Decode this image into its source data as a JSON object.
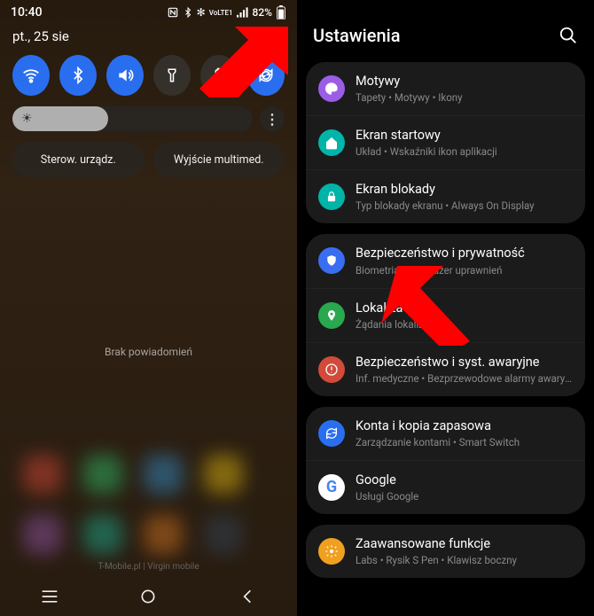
{
  "status": {
    "time": "10:40",
    "battery": "82%",
    "lte_label": "VoLTE1"
  },
  "date": "pt., 25 sie",
  "toggles": [
    {
      "name": "wifi",
      "on": true
    },
    {
      "name": "bluetooth",
      "on": true
    },
    {
      "name": "sound",
      "on": true
    },
    {
      "name": "flashlight",
      "on": false
    },
    {
      "name": "power-saving",
      "on": false
    },
    {
      "name": "rotate",
      "on": true
    }
  ],
  "brightness_percent": 40,
  "shortcuts": {
    "devices": "Sterow. urządz.",
    "media": "Wyjście multimed."
  },
  "no_notifications": "Brak powiadomień",
  "carrier": "T-Mobile.pl | Virgin mobile",
  "settings_title": "Ustawienia",
  "groups": [
    [
      {
        "icon": "themes",
        "color": "#9b5de5",
        "title": "Motywy",
        "sub": "Tapety  •  Motywy  •  Ikony"
      },
      {
        "icon": "home",
        "color": "#00b4a8",
        "title": "Ekran startowy",
        "sub": "Układ  •  Wskaźniki ikon aplikacji"
      },
      {
        "icon": "lock",
        "color": "#00b4a8",
        "title": "Ekran blokady",
        "sub": "Typ blokady ekranu  •  Always On Display"
      }
    ],
    [
      {
        "icon": "shield",
        "color": "#3a6ef0",
        "title": "Bezpieczeństwo i prywatność",
        "sub": "Biometria  •  Menedżer uprawnień"
      },
      {
        "icon": "location",
        "color": "#2aa84f",
        "title": "Lokalizacja",
        "sub": "Żądania lokalizacji"
      },
      {
        "icon": "sos",
        "color": "#d14a3a",
        "title": "Bezpieczeństwo i syst. awaryjne",
        "sub": "Inf. medyczne  •  Bezprzewodowe alarmy awaryjne"
      }
    ],
    [
      {
        "icon": "sync",
        "color": "#2a6ef0",
        "title": "Konta i kopia zapasowa",
        "sub": "Zarządzanie kontami  •  Smart Switch"
      },
      {
        "icon": "google",
        "color": "#fff",
        "title": "Google",
        "sub": "Usługi Google"
      }
    ],
    [
      {
        "icon": "advanced",
        "color": "#f0a020",
        "title": "Zaawansowane funkcje",
        "sub": "Labs  •  Rysik S Pen  •  Klawisz boczny"
      }
    ]
  ]
}
